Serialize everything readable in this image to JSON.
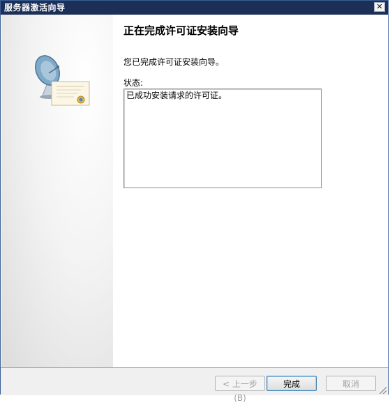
{
  "window": {
    "title": "服务器激活向导",
    "close_glyph": "✕"
  },
  "page": {
    "heading": "正在完成许可证安装向导",
    "description": "您已完成许可证安装向导。",
    "status_label": "状态:",
    "status_text": "已成功安装请求的许可证。"
  },
  "buttons": {
    "back": "< 上一步(B)",
    "finish": "完成",
    "cancel": "取消"
  },
  "icons": {
    "wizard_graphic": "satellite-dish-certificate-icon"
  }
}
